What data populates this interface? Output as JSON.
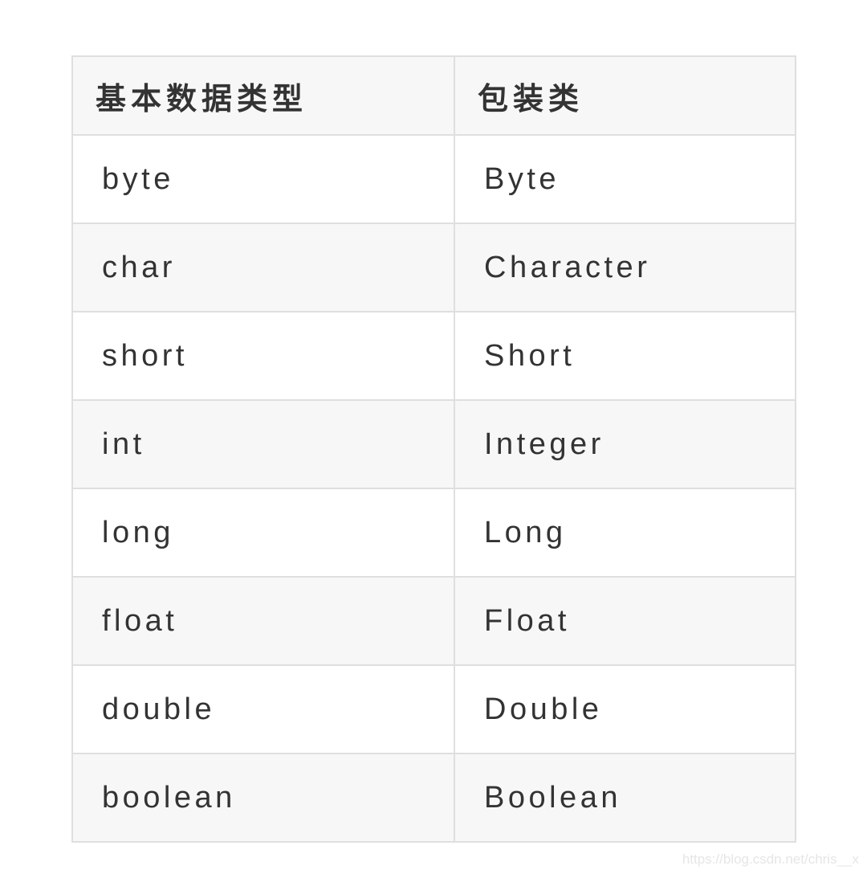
{
  "table": {
    "headers": [
      "基本数据类型",
      "包装类"
    ],
    "rows": [
      [
        "byte",
        "Byte"
      ],
      [
        "char",
        "Character"
      ],
      [
        "short",
        "Short"
      ],
      [
        "int",
        "Integer"
      ],
      [
        "long",
        "Long"
      ],
      [
        "float",
        "Float"
      ],
      [
        "double",
        "Double"
      ],
      [
        "boolean",
        "Boolean"
      ]
    ]
  },
  "watermark": "https://blog.csdn.net/chris__x"
}
